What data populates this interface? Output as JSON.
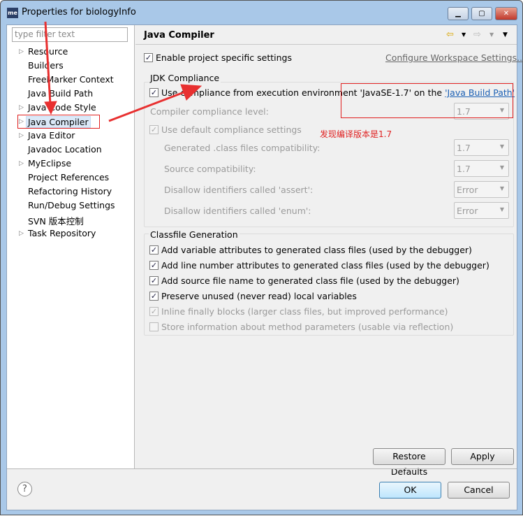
{
  "window": {
    "title": "Properties for biologyInfo",
    "app_icon": "me",
    "controls": [
      "minimize",
      "maximize",
      "close"
    ]
  },
  "sidebar": {
    "filter_placeholder": "type filter text",
    "items": [
      {
        "label": "Resource",
        "expandable": true
      },
      {
        "label": "Builders",
        "expandable": false
      },
      {
        "label": "FreeMarker Context",
        "expandable": false
      },
      {
        "label": "Java Build Path",
        "expandable": false
      },
      {
        "label": "Java Code Style",
        "expandable": true
      },
      {
        "label": "Java Compiler",
        "expandable": true,
        "selected": true
      },
      {
        "label": "Java Editor",
        "expandable": true
      },
      {
        "label": "Javadoc Location",
        "expandable": false
      },
      {
        "label": "MyEclipse",
        "expandable": true
      },
      {
        "label": "Project References",
        "expandable": false
      },
      {
        "label": "Refactoring History",
        "expandable": false
      },
      {
        "label": "Run/Debug Settings",
        "expandable": false
      },
      {
        "label": "SVN 版本控制",
        "expandable": false
      },
      {
        "label": "Task Repository",
        "expandable": true
      }
    ]
  },
  "page": {
    "title": "Java Compiler",
    "enable_label": "Enable project specific settings",
    "enable_checked": true,
    "configure_link": "Configure Workspace Settings...",
    "jdk": {
      "title": "JDK Compliance",
      "use_env_label": "Use compliance from execution environment 'JavaSE-1.7' on the ",
      "use_env_link": "'Java Build Path'",
      "use_env_checked": true,
      "level_label": "Compiler compliance level:",
      "level_value": "1.7",
      "default_label": "Use default compliance settings",
      "default_checked": true,
      "rows": [
        {
          "label": "Generated .class files compatibility:",
          "value": "1.7"
        },
        {
          "label": "Source compatibility:",
          "value": "1.7"
        },
        {
          "label": "Disallow identifiers called 'assert':",
          "value": "Error"
        },
        {
          "label": "Disallow identifiers called 'enum':",
          "value": "Error"
        }
      ]
    },
    "classfile": {
      "title": "Classfile Generation",
      "options": [
        {
          "label": "Add variable attributes to generated class files (used by the debugger)",
          "checked": true,
          "enabled": true
        },
        {
          "label": "Add line number attributes to generated class files (used by the debugger)",
          "checked": true,
          "enabled": true
        },
        {
          "label": "Add source file name to generated class file (used by the debugger)",
          "checked": true,
          "enabled": true
        },
        {
          "label": "Preserve unused (never read) local variables",
          "checked": true,
          "enabled": true
        },
        {
          "label": "Inline finally blocks (larger class files, but improved performance)",
          "checked": true,
          "enabled": false
        },
        {
          "label": "Store information about method parameters (usable via reflection)",
          "checked": false,
          "enabled": false
        }
      ]
    },
    "restore_label": "Restore Defaults",
    "apply_label": "Apply"
  },
  "footer": {
    "ok_label": "OK",
    "cancel_label": "Cancel"
  },
  "annotation": {
    "note": "发现编译版本是1.7",
    "color": "#e02020"
  }
}
